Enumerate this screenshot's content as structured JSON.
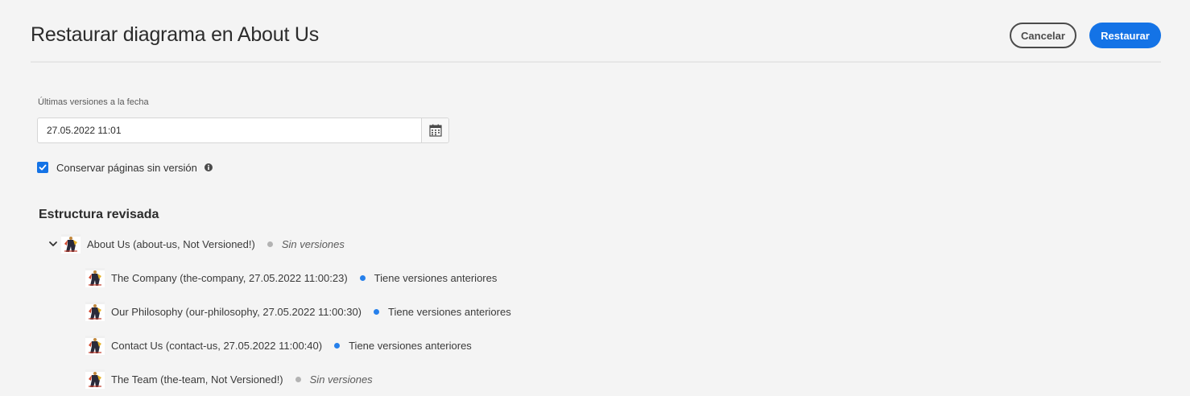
{
  "header": {
    "title": "Restaurar diagrama en About Us",
    "cancel_label": "Cancelar",
    "restore_label": "Restaurar"
  },
  "form": {
    "date_label": "Últimas versiones a la fecha",
    "date_value": "27.05.2022 11:01",
    "checkbox_label": "Conservar páginas sin versión",
    "checkbox_checked": true
  },
  "tree": {
    "title": "Estructura revisada",
    "root": {
      "label": "About Us (about-us, Not Versioned!)",
      "status": "Sin versiones",
      "status_color": "#b3b3b3",
      "expanded": true
    },
    "children": [
      {
        "label": "The Company (the-company, 27.05.2022 11:00:23)",
        "status": "Tiene versiones anteriores",
        "status_color": "#2680eb"
      },
      {
        "label": "Our Philosophy (our-philosophy, 27.05.2022 11:00:30)",
        "status": "Tiene versiones anteriores",
        "status_color": "#2680eb"
      },
      {
        "label": "Contact Us (contact-us, 27.05.2022 11:00:40)",
        "status": "Tiene versiones anteriores",
        "status_color": "#2680eb"
      },
      {
        "label": "The Team (the-team, Not Versioned!)",
        "status": "Sin versiones",
        "status_color": "#b3b3b3"
      }
    ]
  },
  "colors": {
    "accent": "#1473e6",
    "background": "#f4f4f4"
  }
}
